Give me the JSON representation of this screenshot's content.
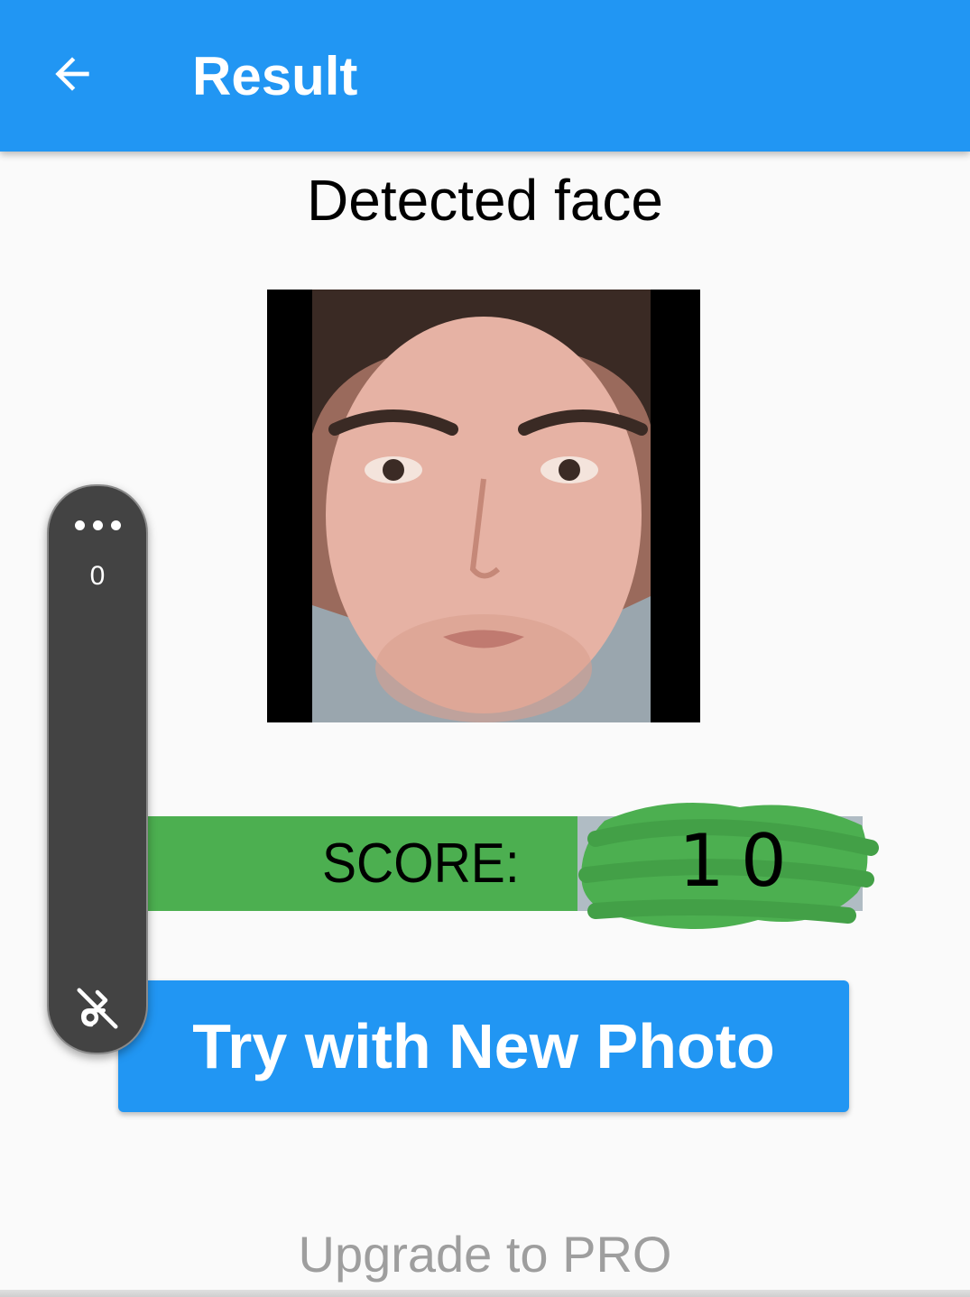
{
  "appbar": {
    "title": "Result",
    "back_icon": "arrow-left-icon",
    "color": "#2196f3"
  },
  "main": {
    "section_title": "Detected face",
    "photo_alt": "Detected face photo",
    "score_label": "SCORE:",
    "score_value": "10",
    "score_bar_color": "#4caf50",
    "primary_button": "Try with New Photo",
    "upgrade_link": "Upgrade to PRO"
  },
  "floating_panel": {
    "menu_icon": "more-horizontal-icon",
    "count": "0",
    "tool_icon": "pointer-off-icon"
  }
}
